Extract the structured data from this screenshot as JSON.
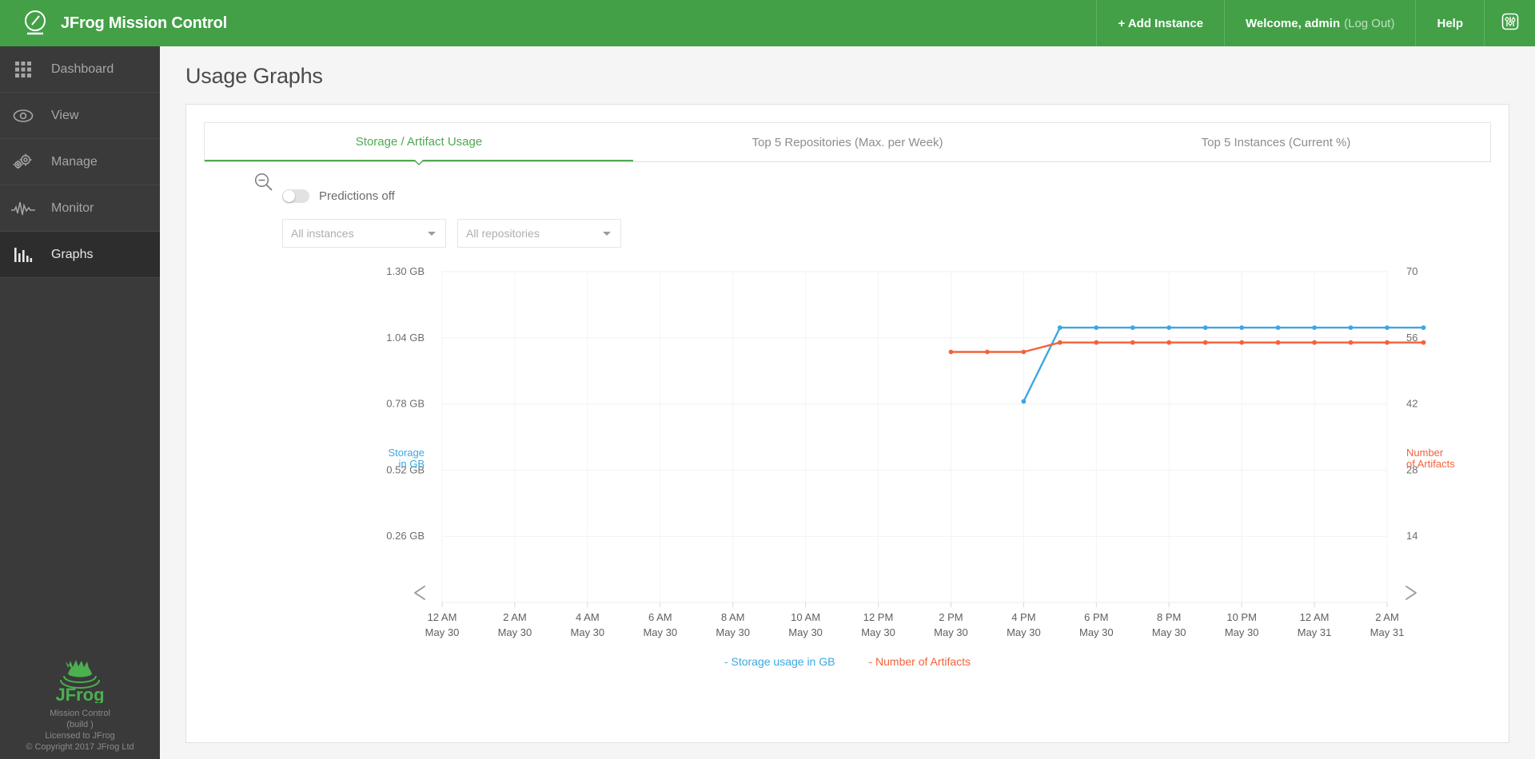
{
  "header": {
    "brand_title": "JFrog Mission Control",
    "brand_logo_icon": "gauge-icon",
    "nav": [
      {
        "label": "+ Add Instance",
        "name": "add-instance"
      },
      {
        "label": "Welcome, admin",
        "muted": "(Log Out)",
        "name": "user-menu"
      },
      {
        "label": "Help",
        "name": "help"
      }
    ],
    "settings_icon": "sliders-icon"
  },
  "sidebar": {
    "items": [
      {
        "label": "Dashboard",
        "icon": "grid-icon",
        "active": false
      },
      {
        "label": "View",
        "icon": "eye-icon",
        "active": false
      },
      {
        "label": "Manage",
        "icon": "gears-icon",
        "active": false
      },
      {
        "label": "Monitor",
        "icon": "pulse-icon",
        "active": false
      },
      {
        "label": "Graphs",
        "icon": "bar-chart-icon",
        "active": true
      }
    ],
    "footer": {
      "logo_icon": "jfrog-logo-icon",
      "line1": "Mission Control",
      "line2": "(build )",
      "line3": "Licensed to JFrog",
      "line4": "© Copyright 2017 JFrog Ltd"
    }
  },
  "page": {
    "title": "Usage Graphs",
    "tabs": [
      {
        "label": "Storage / Artifact Usage",
        "active": true
      },
      {
        "label": "Top 5 Repositories (Max. per Week)",
        "active": false
      },
      {
        "label": "Top 5 Instances (Current %)",
        "active": false
      }
    ],
    "controls": {
      "zoom_out_icon": "zoom-out-icon",
      "predictions_label": "Predictions off",
      "predictions_on": false,
      "instances_select": "All instances",
      "repositories_select": "All repositories"
    }
  },
  "colors": {
    "brand_green": "#43a047",
    "tab_active": "#4fa851",
    "storage_blue": "#3aa8e0",
    "artifacts_orange": "#f4623a",
    "sidebar_bg": "#3a3a3a",
    "grid": "#f0f0f0"
  },
  "chart_data": {
    "type": "line",
    "title": "",
    "xlabel": "",
    "grid": true,
    "legend_position": "bottom",
    "y_left": {
      "label": "Storage\nin GB",
      "label_line1": "Storage",
      "label_line2": "in GB",
      "ticks": [
        "1.30 GB",
        "1.04 GB",
        "0.78 GB",
        "0.52 GB",
        "0.26 GB"
      ],
      "tick_values": [
        1.3,
        1.04,
        0.78,
        0.52,
        0.26
      ],
      "ylim": [
        0,
        1.3
      ],
      "color": "#3aa8e0"
    },
    "y_right": {
      "label_line1": "Number",
      "label_line2": "of Artifacts",
      "ticks": [
        "70",
        "56",
        "42",
        "28",
        "14"
      ],
      "tick_values": [
        70,
        56,
        42,
        28,
        14
      ],
      "ylim": [
        0,
        70
      ],
      "color": "#f4623a"
    },
    "x_ticks": [
      {
        "time": "12 AM",
        "date": "May 30"
      },
      {
        "time": "2 AM",
        "date": "May 30"
      },
      {
        "time": "4 AM",
        "date": "May 30"
      },
      {
        "time": "6 AM",
        "date": "May 30"
      },
      {
        "time": "8 AM",
        "date": "May 30"
      },
      {
        "time": "10 AM",
        "date": "May 30"
      },
      {
        "time": "12 PM",
        "date": "May 30"
      },
      {
        "time": "2 PM",
        "date": "May 30"
      },
      {
        "time": "4 PM",
        "date": "May 30"
      },
      {
        "time": "6 PM",
        "date": "May 30"
      },
      {
        "time": "8 PM",
        "date": "May 30"
      },
      {
        "time": "10 PM",
        "date": "May 30"
      },
      {
        "time": "12 AM",
        "date": "May 31"
      },
      {
        "time": "2 AM",
        "date": "May 31"
      }
    ],
    "nav_prev_icon": "chevron-left-icon",
    "nav_next_icon": "chevron-right-icon",
    "legend": [
      {
        "label": "- Storage usage in GB",
        "color": "#3aa8e0"
      },
      {
        "label": "- Number of Artifacts",
        "color": "#f4623a"
      }
    ],
    "series": [
      {
        "name": "Storage usage in GB",
        "color": "#3aa8e0",
        "axis": "left",
        "x": [
          "4 PM May 30",
          "5 PM May 30",
          "6 PM May 30",
          "7 PM May 30",
          "8 PM May 30",
          "9 PM May 30",
          "10 PM May 30",
          "11 PM May 30",
          "12 AM May 31",
          "1 AM May 31",
          "2 AM May 31",
          "3 AM May 31"
        ],
        "values": [
          0.79,
          1.08,
          1.08,
          1.08,
          1.08,
          1.08,
          1.08,
          1.08,
          1.08,
          1.08,
          1.08,
          1.08
        ]
      },
      {
        "name": "Number of Artifacts",
        "color": "#f4623a",
        "axis": "right",
        "x": [
          "2 PM May 30",
          "3 PM May 30",
          "4 PM May 30",
          "5 PM May 30",
          "6 PM May 30",
          "7 PM May 30",
          "8 PM May 30",
          "9 PM May 30",
          "10 PM May 30",
          "11 PM May 30",
          "12 AM May 31",
          "1 AM May 31",
          "2 AM May 31",
          "3 AM May 31"
        ],
        "values": [
          53,
          53,
          53,
          55,
          55,
          55,
          55,
          55,
          55,
          55,
          55,
          55,
          55,
          55
        ]
      }
    ]
  }
}
